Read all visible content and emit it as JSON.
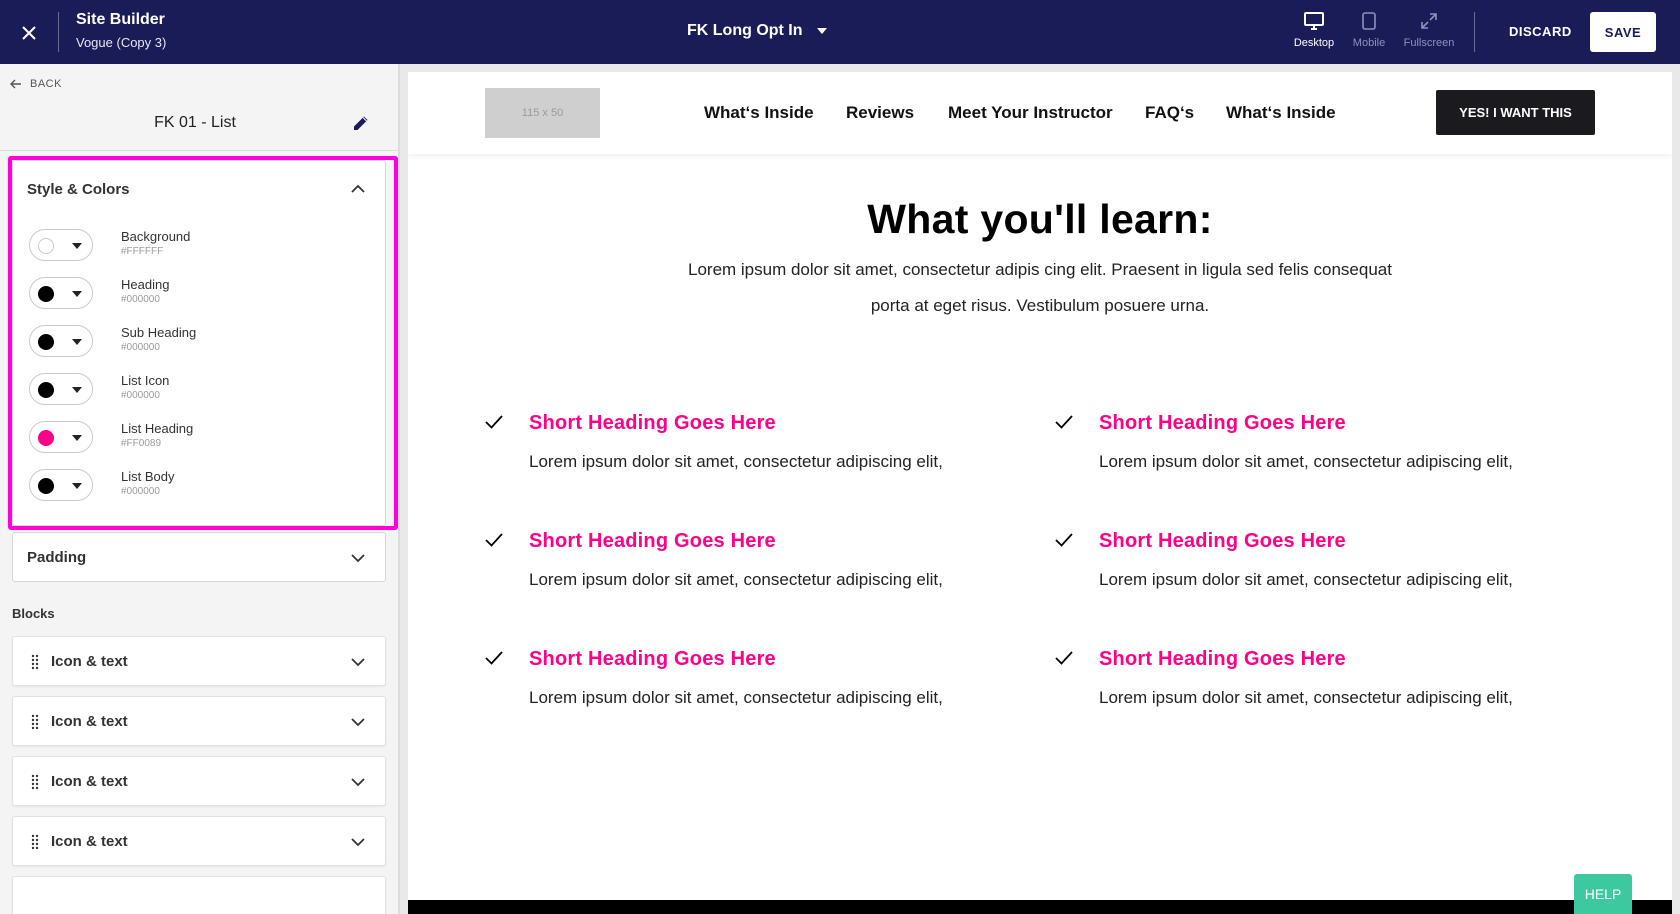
{
  "topbar": {
    "title": "Site Builder",
    "subtitle": "Vogue (Copy 3)",
    "page_name": "FK Long Opt In",
    "views": [
      {
        "label": "Desktop",
        "icon": "monitor-icon",
        "active": true
      },
      {
        "label": "Mobile",
        "icon": "phone-icon",
        "active": false
      },
      {
        "label": "Fullscreen",
        "icon": "expand-icon",
        "active": false
      }
    ],
    "discard_label": "DISCARD",
    "save_label": "SAVE",
    "bg_color": "#1a1c58"
  },
  "sidebar": {
    "back_label": "BACK",
    "section_title": "FK 01 - List",
    "style_panel": {
      "title": "Style & Colors",
      "colors": [
        {
          "name": "Background",
          "hex": "#FFFFFF"
        },
        {
          "name": "Heading",
          "hex": "#000000"
        },
        {
          "name": "Sub Heading",
          "hex": "#000000"
        },
        {
          "name": "List Icon",
          "hex": "#000000"
        },
        {
          "name": "List Heading",
          "hex": "#FF0089"
        },
        {
          "name": "List Body",
          "hex": "#000000"
        }
      ]
    },
    "padding_panel": {
      "title": "Padding"
    },
    "blocks_label": "Blocks",
    "blocks": [
      {
        "label": "Icon & text"
      },
      {
        "label": "Icon & text"
      },
      {
        "label": "Icon & text"
      },
      {
        "label": "Icon & text"
      }
    ],
    "highlight_color": "#ff00dd"
  },
  "site": {
    "logo_placeholder": "115 x 50",
    "nav": [
      "What‘s Inside",
      "Reviews",
      "Meet Your Instructor",
      "FAQ‘s",
      "What‘s Inside"
    ],
    "cta_label": "YES! I WANT THIS",
    "heading": "What you'll learn:",
    "subheading": "Lorem ipsum dolor sit amet, consectetur adipis cing elit. Praesent in ligula sed felis consequat porta at eget risus. Vestibulum posuere urna.",
    "features": [
      {
        "heading": "Short Heading Goes Here",
        "body": "Lorem ipsum dolor sit amet, consectetur adipiscing elit,"
      },
      {
        "heading": "Short Heading Goes Here",
        "body": "Lorem ipsum dolor sit amet, consectetur adipiscing elit,"
      },
      {
        "heading": "Short Heading Goes Here",
        "body": "Lorem ipsum dolor sit amet, consectetur adipiscing elit,"
      },
      {
        "heading": "Short Heading Goes Here",
        "body": "Lorem ipsum dolor sit amet, consectetur adipiscing elit,"
      },
      {
        "heading": "Short Heading Goes Here",
        "body": "Lorem ipsum dolor sit amet, consectetur adipiscing elit,"
      },
      {
        "heading": "Short Heading Goes Here",
        "body": "Lorem ipsum dolor sit amet, consectetur adipiscing elit,"
      }
    ],
    "accent_color": "#ff0089"
  },
  "help_label": "HELP"
}
